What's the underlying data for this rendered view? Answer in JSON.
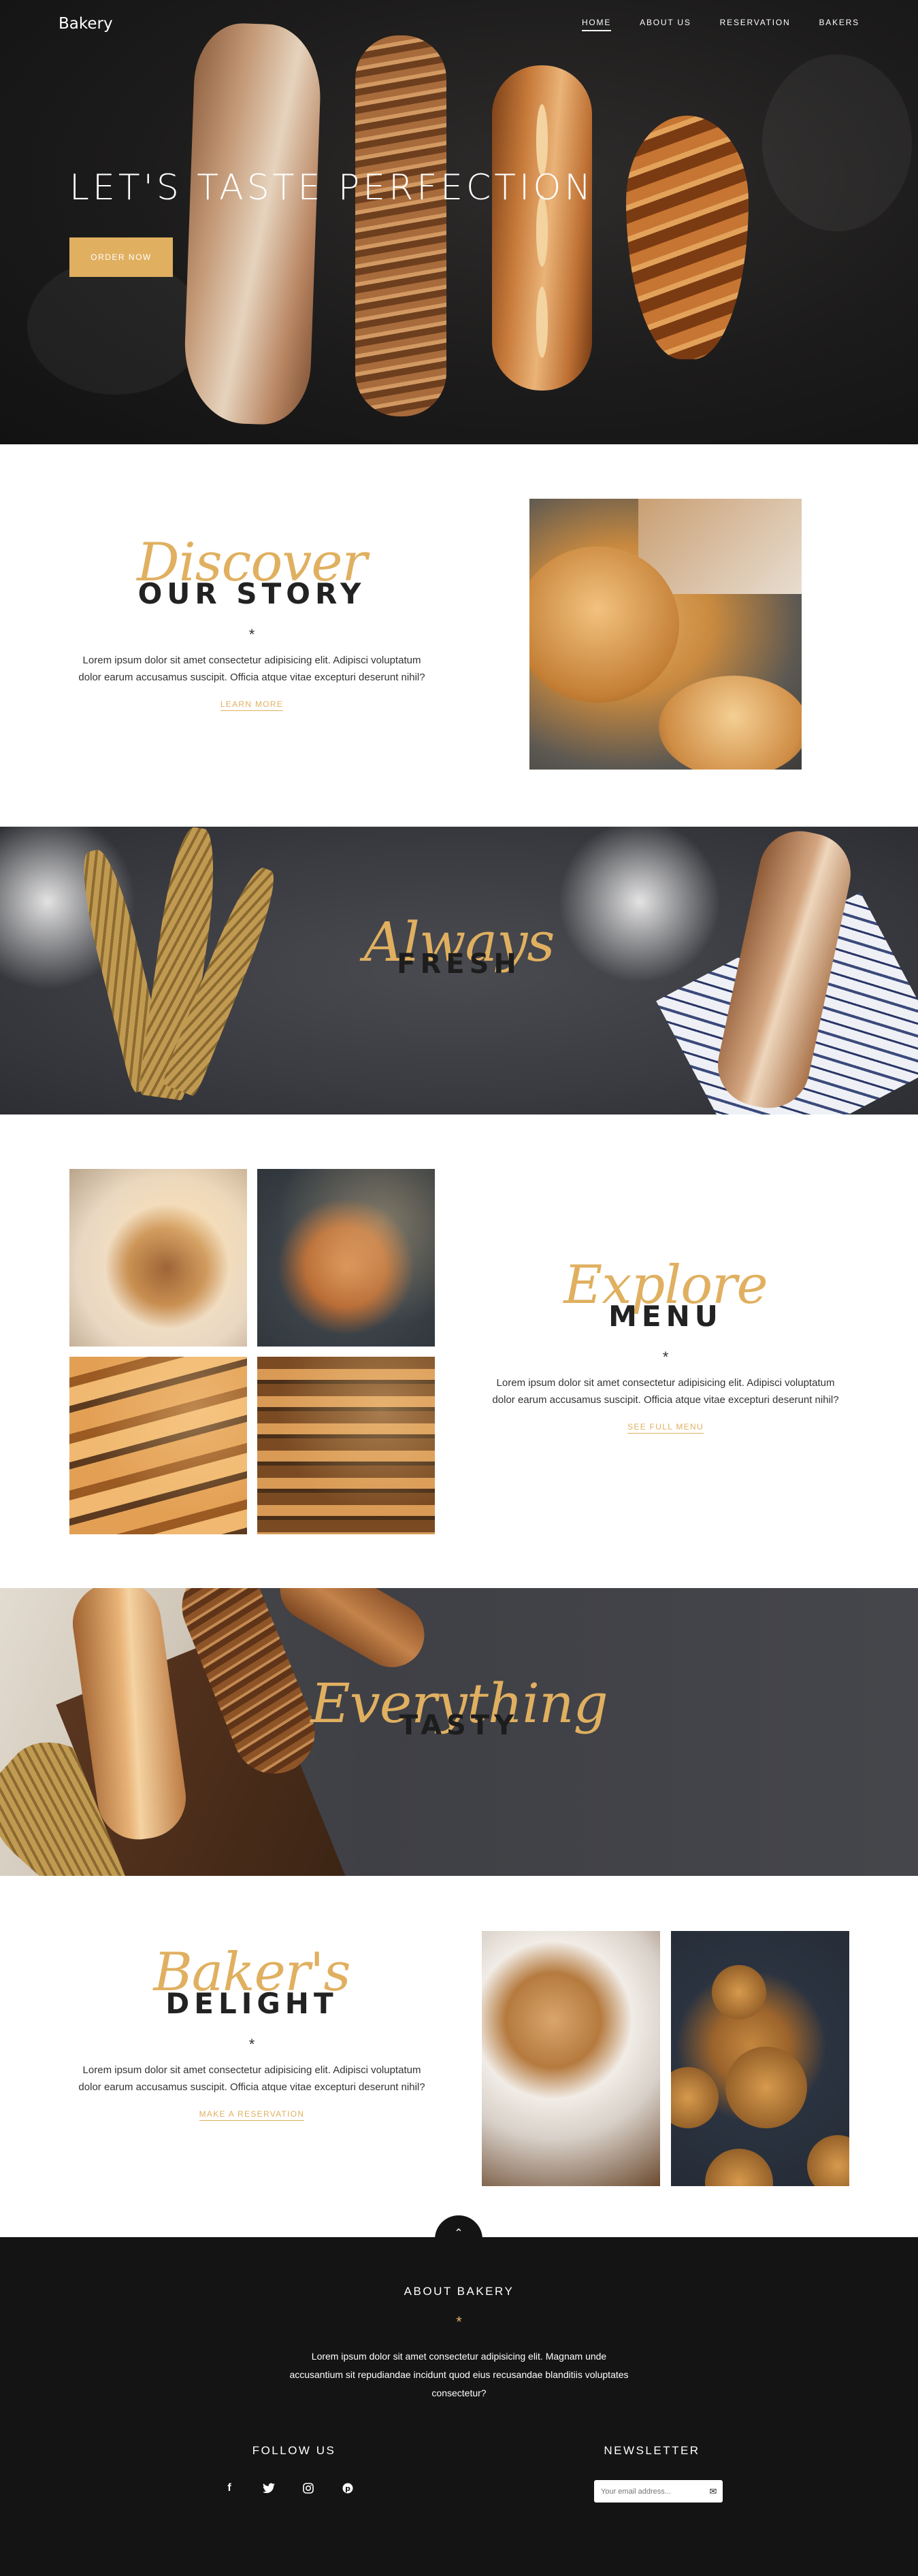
{
  "brand": "Bakery",
  "nav": {
    "items": [
      {
        "label": "HOME",
        "active": true
      },
      {
        "label": "ABOUT US",
        "active": false
      },
      {
        "label": "RESERVATION",
        "active": false
      },
      {
        "label": "BAKERS",
        "active": false
      }
    ]
  },
  "hero": {
    "title": "LET'S TASTE PERFECTION",
    "button": "ORDER NOW"
  },
  "story": {
    "script": "Discover",
    "heading": "OUR STORY",
    "star": "*",
    "text": "Lorem ipsum dolor sit amet consectetur adipisicing elit. Adipisci voluptatum dolor earum accusamus suscipit. Officia atque vitae excepturi deserunt nihil?",
    "link": "LEARN MORE"
  },
  "banner1": {
    "script": "Always",
    "heading": "FRESH"
  },
  "menu": {
    "script": "Explore",
    "heading": "MENU",
    "star": "*",
    "text": "Lorem ipsum dolor sit amet consectetur adipisicing elit. Adipisci voluptatum dolor earum accusamus suscipit. Officia atque vitae excepturi deserunt nihil?",
    "link": "SEE FULL MENU"
  },
  "banner2": {
    "script": "Everything",
    "heading": "TASTY"
  },
  "delight": {
    "script": "Baker's",
    "heading": "DELIGHT",
    "star": "*",
    "text": "Lorem ipsum dolor sit amet consectetur adipisicing elit. Adipisci voluptatum dolor earum accusamus suscipit. Officia atque vitae excepturi deserunt nihil?",
    "link": "MAKE A RESERVATION"
  },
  "footer": {
    "about_title": "ABOUT BAKERY",
    "star": "*",
    "about_text": "Lorem ipsum dolor sit amet consectetur adipisicing elit. Magnam unde accusantium sit repudiandae incidunt quod eius recusandae blanditiis voluptates consectetur?",
    "follow_title": "FOLLOW US",
    "socials": [
      "facebook-icon",
      "twitter-icon",
      "instagram-icon",
      "pinterest-icon"
    ],
    "newsletter_title": "NEWSLETTER",
    "newsletter_placeholder": "Your email address..."
  },
  "colors": {
    "accent": "#e0b060",
    "dark": "#141414",
    "heading": "#222222"
  }
}
